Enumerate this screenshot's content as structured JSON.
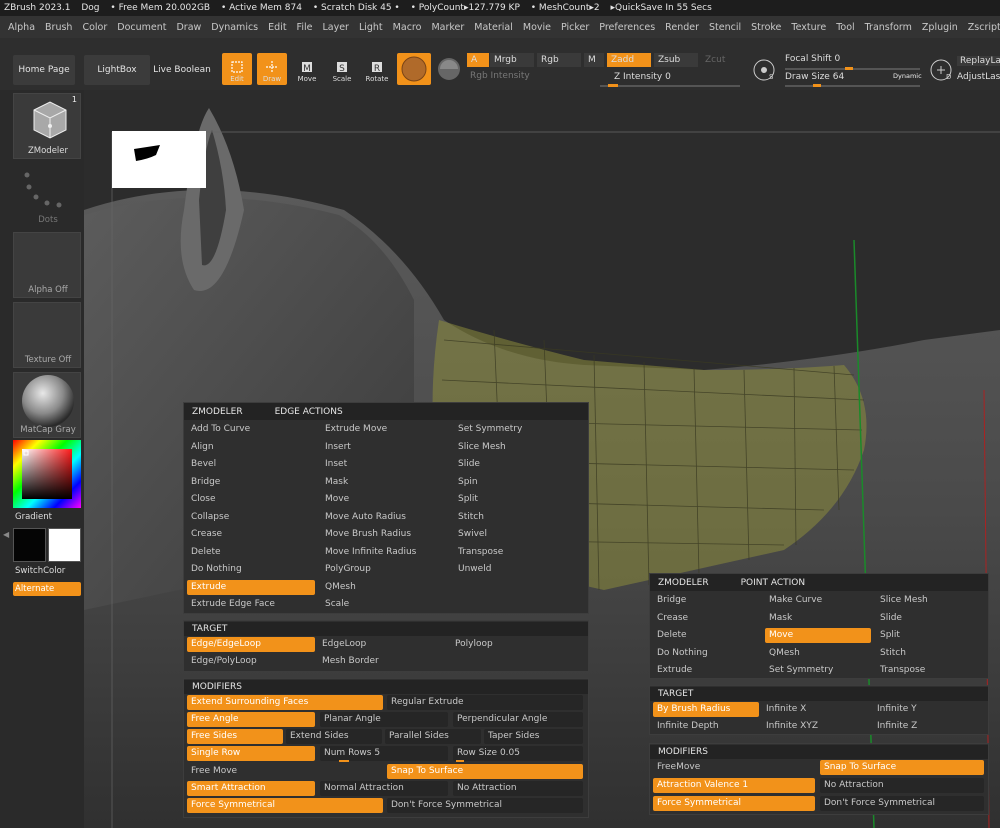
{
  "titlebar": {
    "app": "ZBrush 2023.1",
    "doc": "Dog",
    "free_mem": "• Free Mem 20.002GB",
    "active_mem": "• Active Mem 874",
    "scratch": "• Scratch Disk 45 •",
    "polycount": "• PolyCount▸127.779 KP",
    "meshcount": "• MeshCount▸2",
    "quicksave": "▸QuickSave In 55 Secs"
  },
  "menu": [
    "Alpha",
    "Brush",
    "Color",
    "Document",
    "Draw",
    "Dynamics",
    "Edit",
    "File",
    "Layer",
    "Light",
    "Macro",
    "Marker",
    "Material",
    "Movie",
    "Picker",
    "Preferences",
    "Render",
    "Stencil",
    "Stroke",
    "Texture",
    "Tool",
    "Transform",
    "Zplugin",
    "Zscript",
    "Help"
  ],
  "shelf": {
    "home_page": "Home Page",
    "lightbox": "LightBox",
    "live_boolean": "Live Boolean",
    "edit": "Edit",
    "draw": "Draw",
    "move": "Move",
    "scale": "Scale",
    "rotate": "Rotate",
    "a": "A",
    "mrgb": "Mrgb",
    "rgb": "Rgb",
    "m": "M",
    "zadd": "Zadd",
    "zsub": "Zsub",
    "zcut": "Zcut",
    "rgb_intensity": "Rgb Intensity",
    "z_intensity": "Z Intensity",
    "z_intensity_value": "0",
    "focal_shift": "Focal Shift",
    "focal_shift_value": "0",
    "draw_size": "Draw Size",
    "draw_size_value": "64",
    "dynamic": "Dynamic",
    "replay_last": "ReplayLas",
    "adjust_last": "AdjustLas"
  },
  "left": {
    "zmodeler": "ZModeler",
    "zmodeler_badge": "1",
    "dots": "Dots",
    "alpha_off": "Alpha Off",
    "texture_off": "Texture Off",
    "matcap": "MatCap Gray",
    "gradient": "Gradient",
    "switchcolor": "SwitchColor",
    "alternate": "Alternate"
  },
  "edge_panel": {
    "head_left": "ZMODELER",
    "head_right": "EDGE ACTIONS",
    "col1": [
      "Add To Curve",
      "Align",
      "Bevel",
      "Bridge",
      "Close",
      "Collapse",
      "Crease",
      "Delete",
      "Do Nothing",
      "Extrude",
      "Extrude Edge Face"
    ],
    "col2": [
      "Extrude Move",
      "Insert",
      "Inset",
      "Mask",
      "Move",
      "Move Auto Radius",
      "Move Brush Radius",
      "Move Infinite Radius",
      "PolyGroup",
      "QMesh",
      "Scale"
    ],
    "col3": [
      "Set Symmetry",
      "Slice Mesh",
      "Slide",
      "Spin",
      "Split",
      "Stitch",
      "Swivel",
      "Transpose",
      "Unweld"
    ],
    "selected_action": "Extrude",
    "target_head": "TARGET",
    "targets": [
      "Edge/EdgeLoop",
      "EdgeLoop",
      "Polyloop",
      "Edge/PolyLoop",
      "Mesh Border"
    ],
    "selected_target": "Edge/EdgeLoop",
    "modifiers_head": "MODIFIERS",
    "mods": {
      "extend_surrounding": "Extend Surrounding Faces",
      "regular_extrude": "Regular Extrude",
      "free_angle": "Free Angle",
      "planar_angle": "Planar Angle",
      "perpendicular_angle": "Perpendicular Angle",
      "free_sides": "Free Sides",
      "extend_sides": "Extend Sides",
      "parallel_sides": "Parallel Sides",
      "taper_sides": "Taper Sides",
      "single_row": "Single Row",
      "num_rows": "Num Rows",
      "num_rows_value": "5",
      "row_size": "Row Size",
      "row_size_value": "0.05",
      "free_move": "Free Move",
      "snap_to_surface": "Snap To Surface",
      "smart_attraction": "Smart Attraction",
      "normal_attraction": "Normal Attraction",
      "no_attraction": "No Attraction",
      "force_symmetrical": "Force Symmetrical",
      "dont_force": "Don't Force Symmetrical"
    }
  },
  "point_panel": {
    "head_left": "ZMODELER",
    "head_right": "POINT ACTION",
    "col1": [
      "Bridge",
      "Crease",
      "Delete",
      "Do Nothing",
      "Extrude"
    ],
    "col2": [
      "Make Curve",
      "Mask",
      "Move",
      "QMesh",
      "Set Symmetry"
    ],
    "col3": [
      "Slice Mesh",
      "Slide",
      "Split",
      "Stitch",
      "Transpose"
    ],
    "selected_action": "Move",
    "target_head": "TARGET",
    "targets": [
      "By Brush Radius",
      "Infinite X",
      "Infinite Y",
      "Infinite Depth",
      "Infinite XYZ",
      "Infinite Z"
    ],
    "selected_target": "By Brush Radius",
    "modifiers_head": "MODIFIERS",
    "mods": {
      "freemove": "FreeMove",
      "snap_to_surface": "Snap To Surface",
      "attraction_valence": "Attraction Valence",
      "attraction_valence_value": "1",
      "no_attraction": "No Attraction",
      "force_symmetrical": "Force Symmetrical",
      "dont_force": "Don't Force Symmetrical"
    }
  },
  "colors": {
    "accent": "#f2921a",
    "panel_bg": "#2f2f2f",
    "mesh_highlight": "#8c8c3c"
  }
}
